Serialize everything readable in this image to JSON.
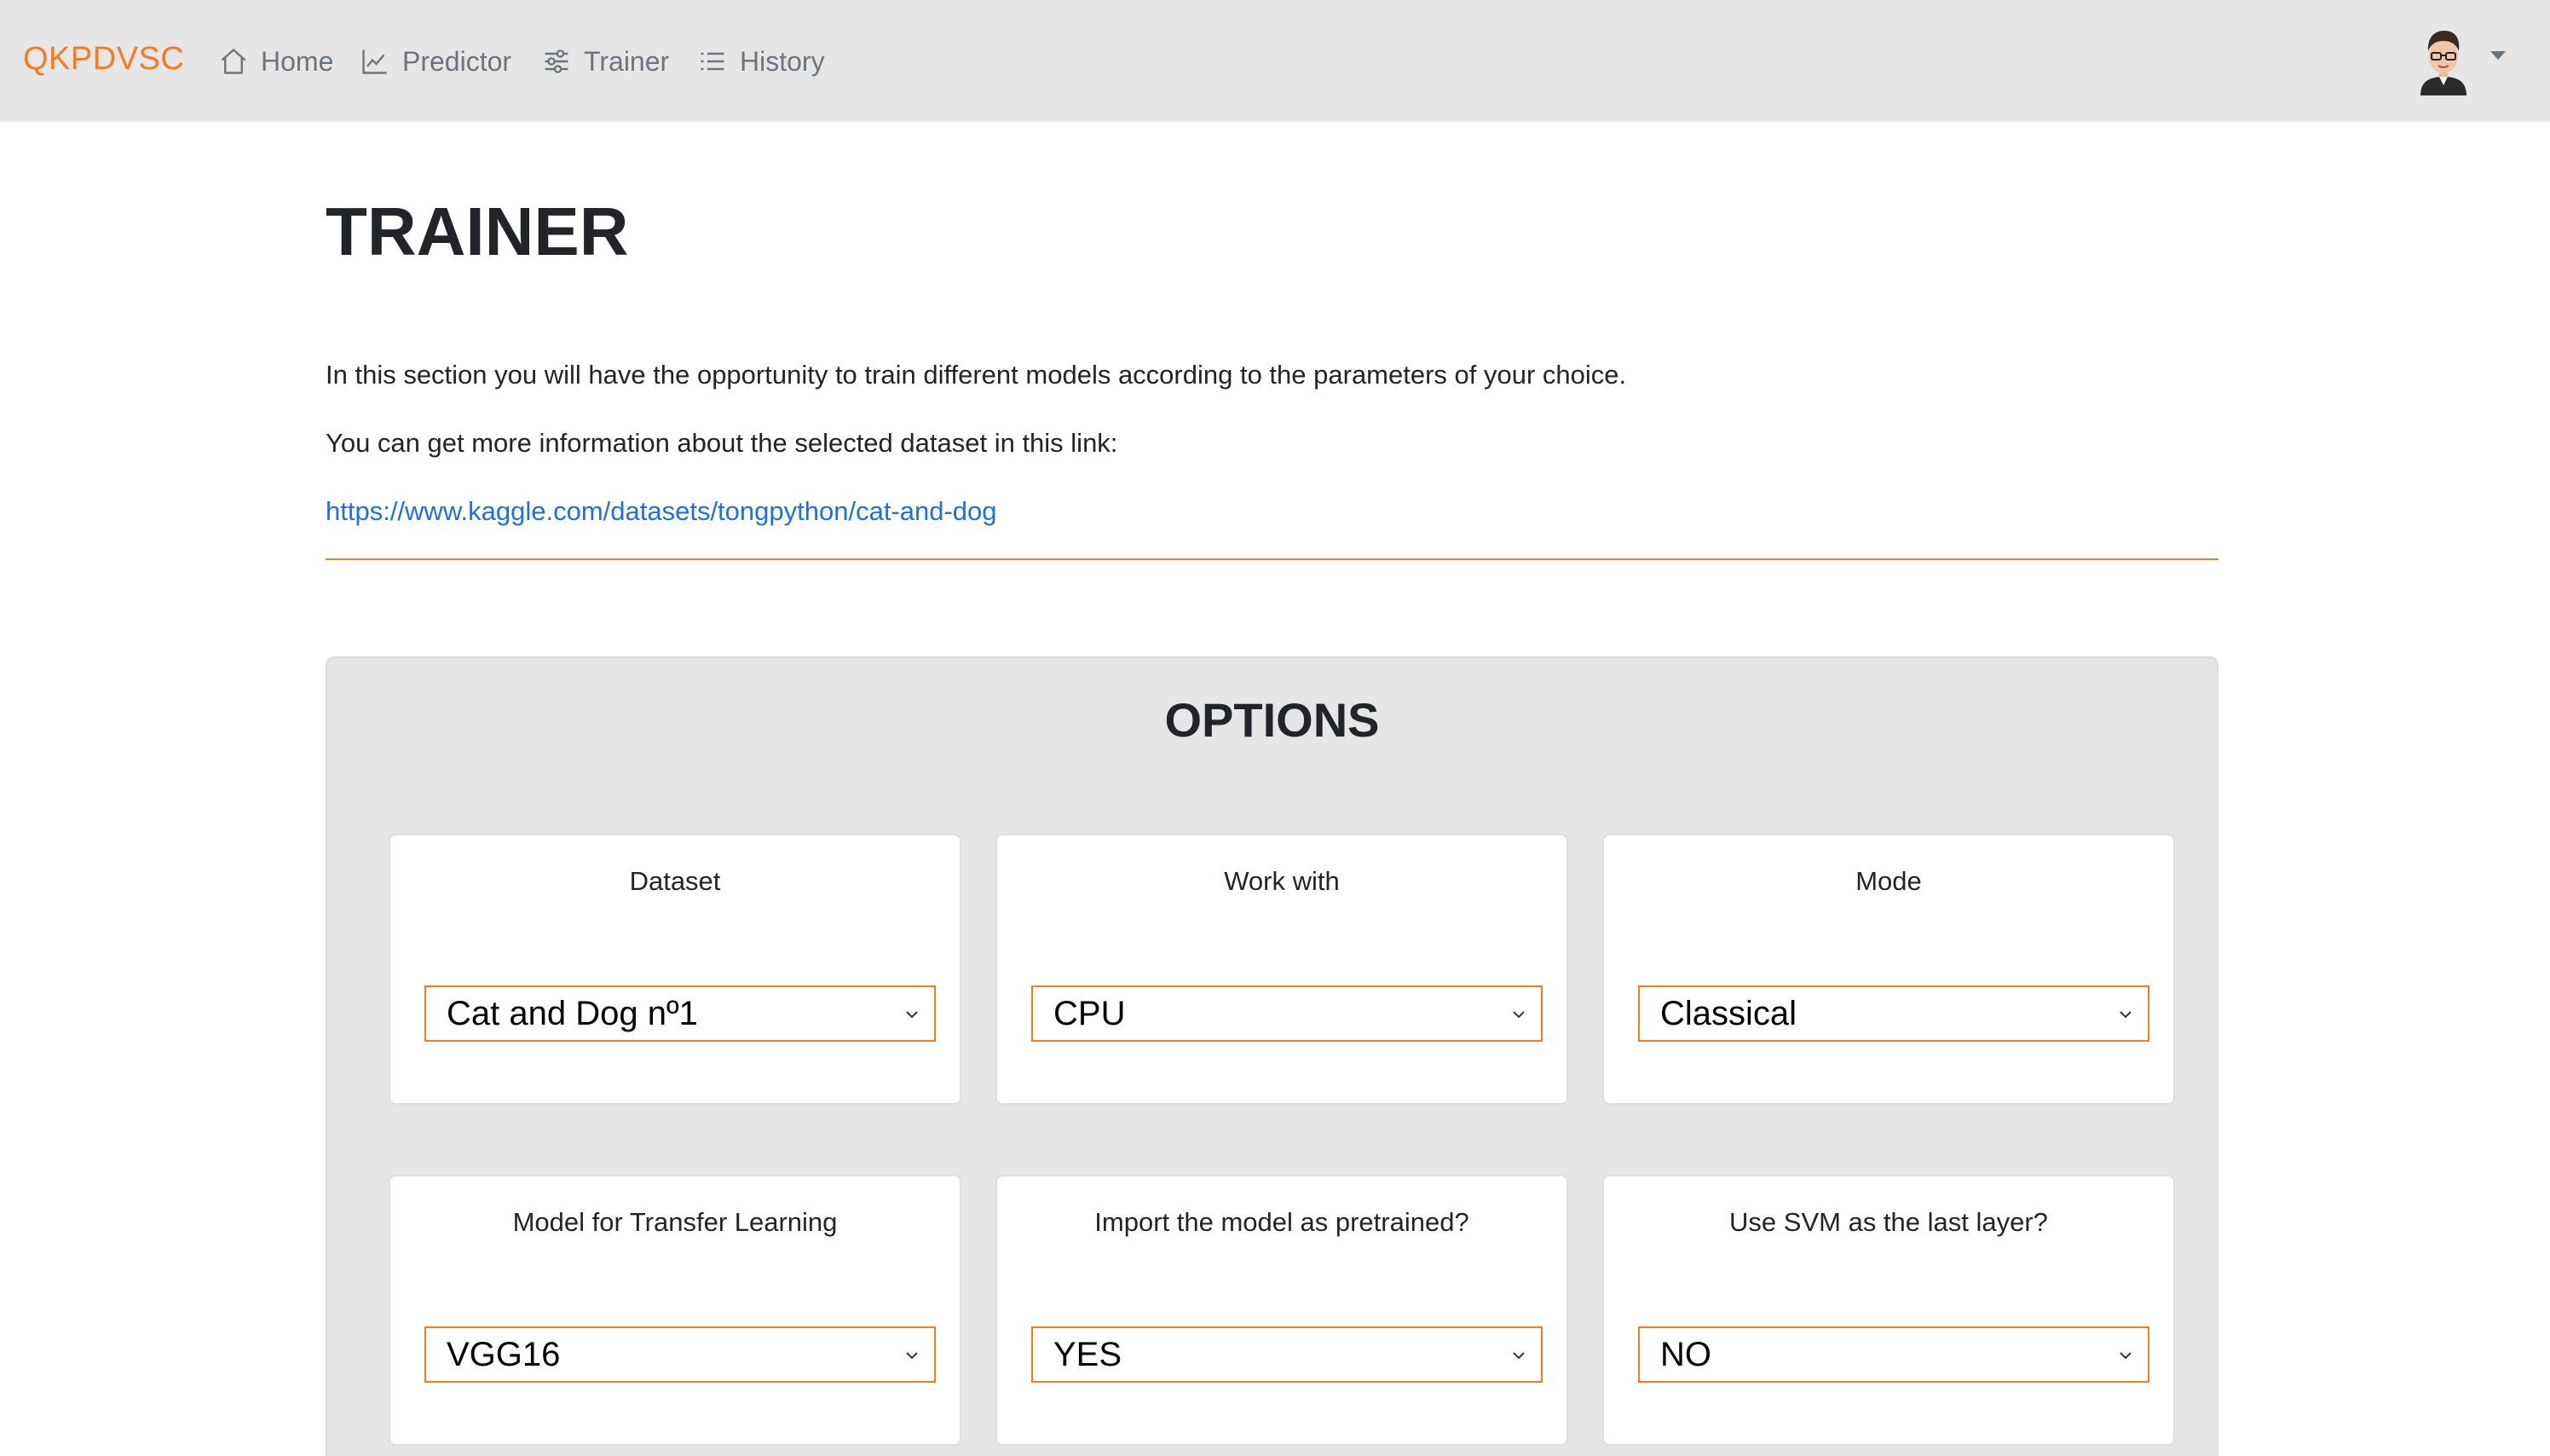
{
  "navbar": {
    "brand": "QKPDVSC",
    "items": [
      {
        "label": "Home",
        "icon": "home-icon"
      },
      {
        "label": "Predictor",
        "icon": "chart-line-icon"
      },
      {
        "label": "Trainer",
        "icon": "sliders-icon"
      },
      {
        "label": "History",
        "icon": "list-icon"
      }
    ],
    "user_icon": "avatar-icon"
  },
  "main": {
    "title": "TRAINER",
    "paragraph1": "In this section you will have the opportunity to train different models according to the parameters of your choice.",
    "paragraph2": "You can get more information about the selected dataset in this link:",
    "link": "https://www.kaggle.com/datasets/tongpython/cat-and-dog"
  },
  "options": {
    "title": "OPTIONS",
    "cards": [
      {
        "label": "Dataset",
        "value": "Cat and Dog nº1"
      },
      {
        "label": "Work with",
        "value": "CPU"
      },
      {
        "label": "Mode",
        "value": "Classical"
      },
      {
        "label": "Model for Transfer Learning",
        "value": "VGG16"
      },
      {
        "label": "Import the model as pretrained?",
        "value": "YES"
      },
      {
        "label": "Use SVM as the last layer?",
        "value": "NO"
      }
    ]
  },
  "colors": {
    "accent": "#f47b20",
    "link": "#1f6fe0",
    "navbar_bg": "#e6e6e6",
    "panel_bg": "#e6e6e6"
  }
}
